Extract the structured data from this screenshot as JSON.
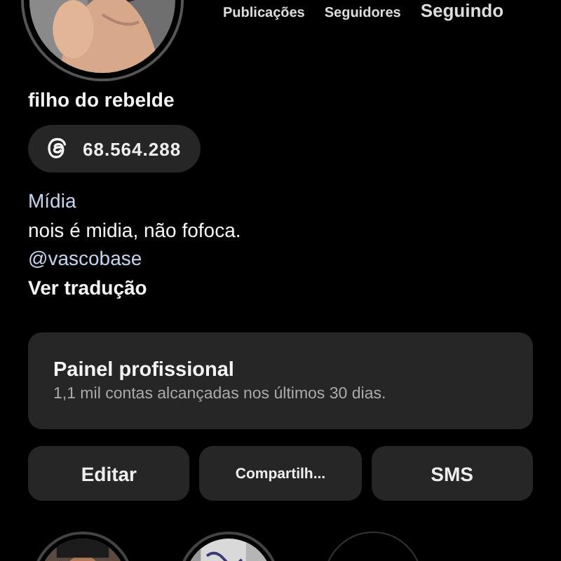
{
  "profile": {
    "avatar": {
      "kind": "picture"
    },
    "stats": [
      "Publicações",
      "Seguidores",
      "Seguindo"
    ],
    "name": "filho do rebelde",
    "threads_badge": "68.564.288",
    "category": "Mídia",
    "bio": "nois é midia, não fofoca.",
    "mention": "@vascobase",
    "translate_link": "Ver tradução"
  },
  "dashboard": {
    "title": "Painel profissional",
    "subtitle": "1,1 mil contas alcançadas nos últimos 30 dias."
  },
  "buttons": [
    "Editar",
    "Compartilh...",
    "SMS"
  ],
  "highlights": [
    {
      "kind": "picture"
    },
    {
      "kind": "picture"
    },
    {
      "kind": "empty"
    }
  ]
}
